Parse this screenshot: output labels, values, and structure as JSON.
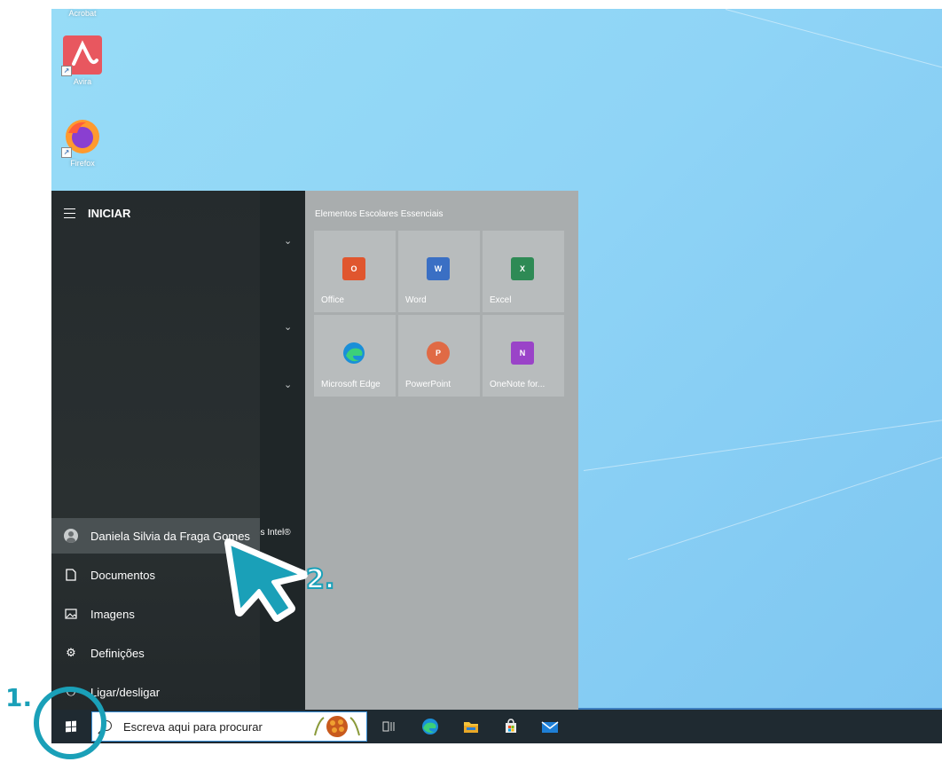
{
  "desktop": {
    "icons": [
      {
        "label": "Acrobat",
        "icon": "acrobat-icon"
      },
      {
        "label": "Avira",
        "icon": "avira-icon"
      },
      {
        "label": "Firefox",
        "icon": "firefox-icon"
      }
    ]
  },
  "start_menu": {
    "header": "INICIAR",
    "partial_group_label": "os Intel®",
    "tiles_group_title": "Elementos Escolares Essenciais",
    "tiles": [
      {
        "label": "Office",
        "icon": "office-icon",
        "color": "#d83b01",
        "glyph": "O"
      },
      {
        "label": "Word",
        "icon": "word-icon",
        "color": "#2b579a",
        "glyph": "W"
      },
      {
        "label": "Excel",
        "icon": "excel-icon",
        "color": "#217346",
        "glyph": "X"
      },
      {
        "label": "Microsoft Edge",
        "icon": "edge-icon",
        "color": "#0c8bd6",
        "glyph": ""
      },
      {
        "label": "PowerPoint",
        "icon": "powerpoint-icon",
        "color": "#d24726",
        "glyph": "P"
      },
      {
        "label": "OneNote for...",
        "icon": "onenote-icon",
        "color": "#7719aa",
        "glyph": "N"
      }
    ],
    "side_items": [
      {
        "label": "Daniela Silvia da Fraga Gomes",
        "icon": "user-avatar-icon"
      },
      {
        "label": "Documentos",
        "icon": "document-icon"
      },
      {
        "label": "Imagens",
        "icon": "pictures-icon"
      },
      {
        "label": "Definições",
        "icon": "settings-gear-icon"
      },
      {
        "label": "Ligar/desligar",
        "icon": "power-icon"
      }
    ]
  },
  "taskbar": {
    "search_placeholder": "Escreva aqui para procurar",
    "pinned": [
      "task-view-icon",
      "edge-icon",
      "file-explorer-icon",
      "store-icon",
      "mail-icon"
    ]
  },
  "annotations": {
    "step1": "1.",
    "step2": "2."
  },
  "colors": {
    "accent": "#1aa0b8",
    "taskbar": "#1f2a31",
    "menu_dark": "#252b2d",
    "tiles_bg": "#a9adae"
  }
}
